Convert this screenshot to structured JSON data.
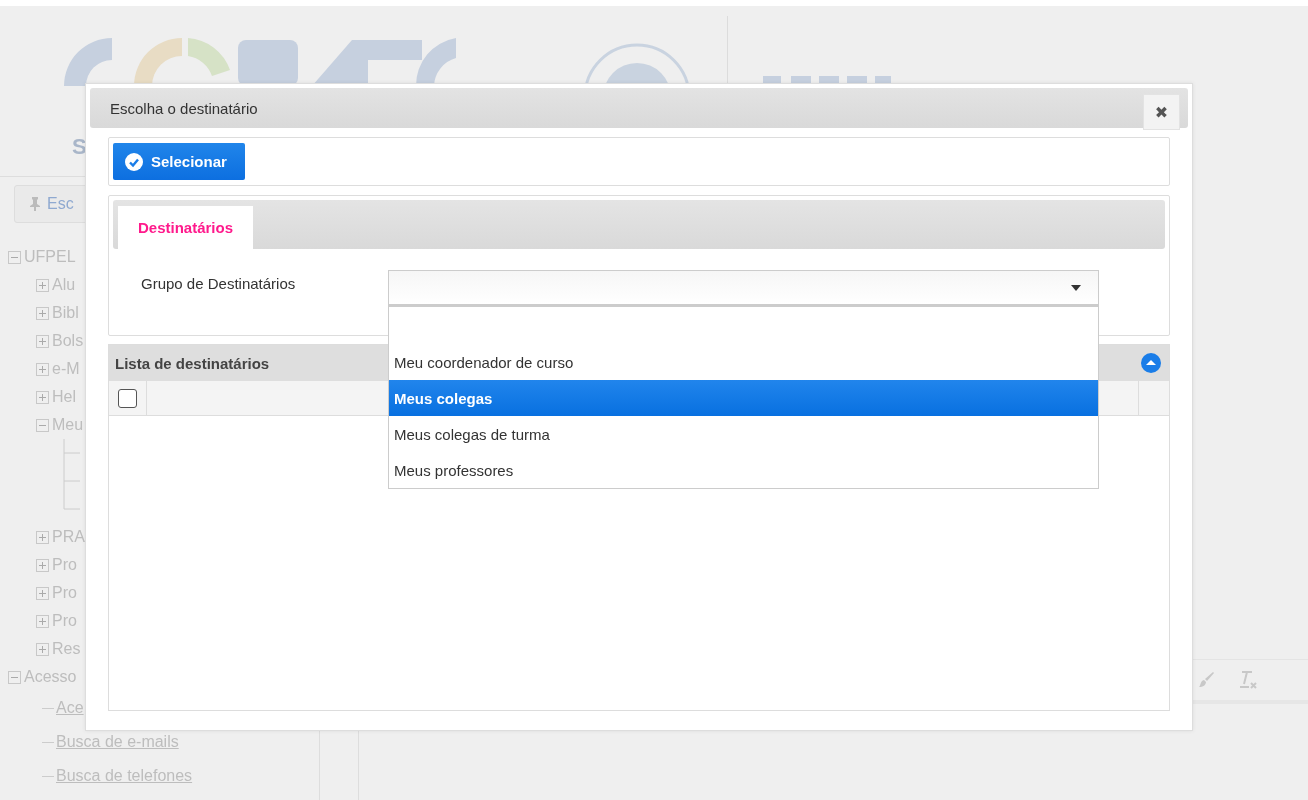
{
  "background": {
    "logo": {
      "subtitle": "S"
    },
    "toolbar_button": "Esc",
    "tree": [
      {
        "label": "UFPEL",
        "expanded": true,
        "children": [
          {
            "label": "Alu",
            "expanded": false
          },
          {
            "label": "Bibl",
            "expanded": false
          },
          {
            "label": "Bols",
            "expanded": false
          },
          {
            "label": "e-M",
            "expanded": false
          },
          {
            "label": "Hel",
            "expanded": false
          },
          {
            "label": "Meu",
            "expanded": true
          },
          {
            "label": "PRA",
            "expanded": false
          },
          {
            "label": "Pro",
            "expanded": false
          },
          {
            "label": "Pro",
            "expanded": false
          },
          {
            "label": "Pro",
            "expanded": false
          },
          {
            "label": "Res",
            "expanded": false
          }
        ]
      },
      {
        "label": "Acesso",
        "expanded": true,
        "links": [
          "Ace",
          "Busca de e-mails",
          "Busca de telefones"
        ]
      }
    ]
  },
  "dialog": {
    "title": "Escolha o destinatário",
    "close": "✖",
    "select_button": "Selecionar",
    "tabs": [
      {
        "label": "Destinatários",
        "selected": true
      }
    ],
    "field": {
      "label": "Grupo de Destinatários",
      "expanded": true,
      "options": [
        {
          "label": "Meu coordenador de curso",
          "selected": false
        },
        {
          "label": "Meus colegas",
          "selected": true
        },
        {
          "label": "Meus colegas de turma",
          "selected": false
        },
        {
          "label": "Meus professores",
          "selected": false
        }
      ]
    },
    "list_panel": {
      "title": "Lista de destinatários",
      "expanded": true,
      "select_all_checked": false
    }
  }
}
